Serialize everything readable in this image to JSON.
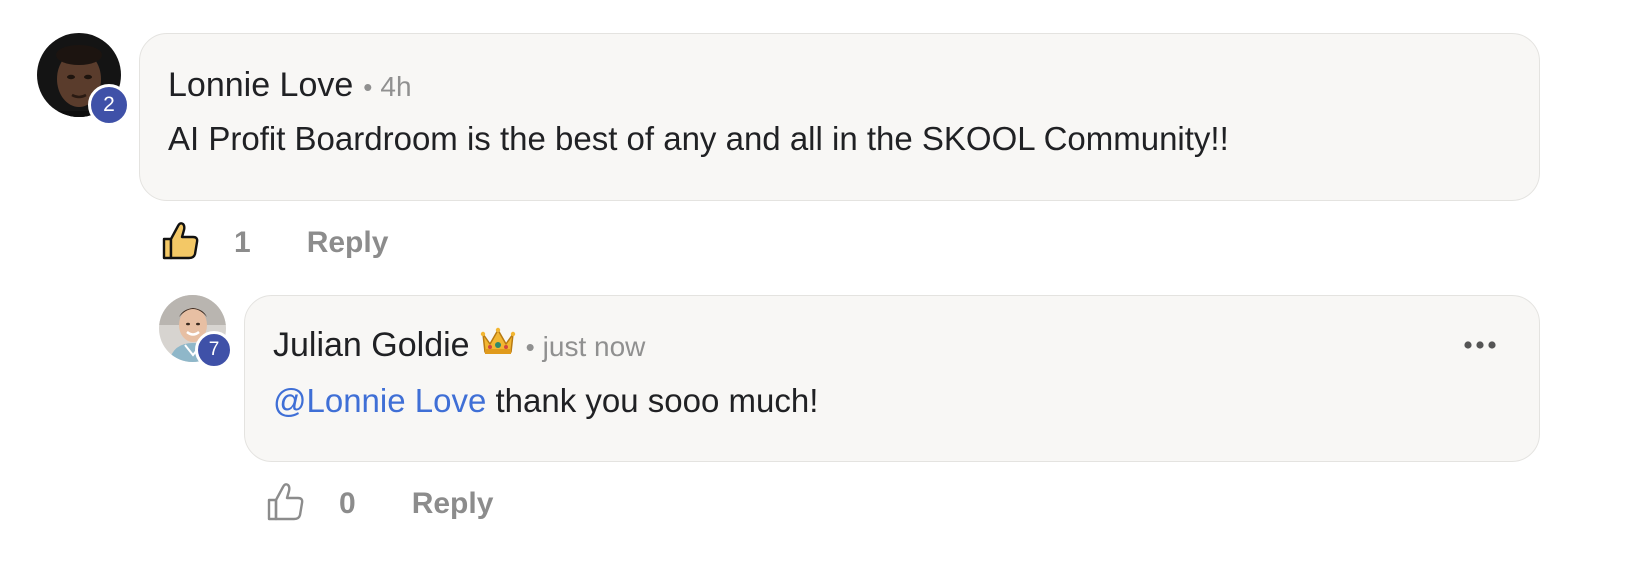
{
  "comments": [
    {
      "author": "Lonnie Love",
      "level": "2",
      "separator": "•",
      "time": "4h",
      "body": "AI Profit Boardroom is the best of any and all in the SKOOL Community!!",
      "likes": "1",
      "liked": true,
      "reply_label": "Reply"
    },
    {
      "author": "Julian Goldie",
      "level": "7",
      "separator": "•",
      "time": "just now",
      "mention": "@Lonnie Love",
      "body": "thank you sooo much!",
      "likes": "0",
      "liked": false,
      "reply_label": "Reply",
      "more_icon": "ellipsis-icon"
    }
  ],
  "colors": {
    "bubble_bg": "#f8f7f5",
    "badge": "#3f51a8",
    "mention": "#3f6fd6",
    "muted": "#8c8c8c",
    "like_active": "#f3c866"
  }
}
